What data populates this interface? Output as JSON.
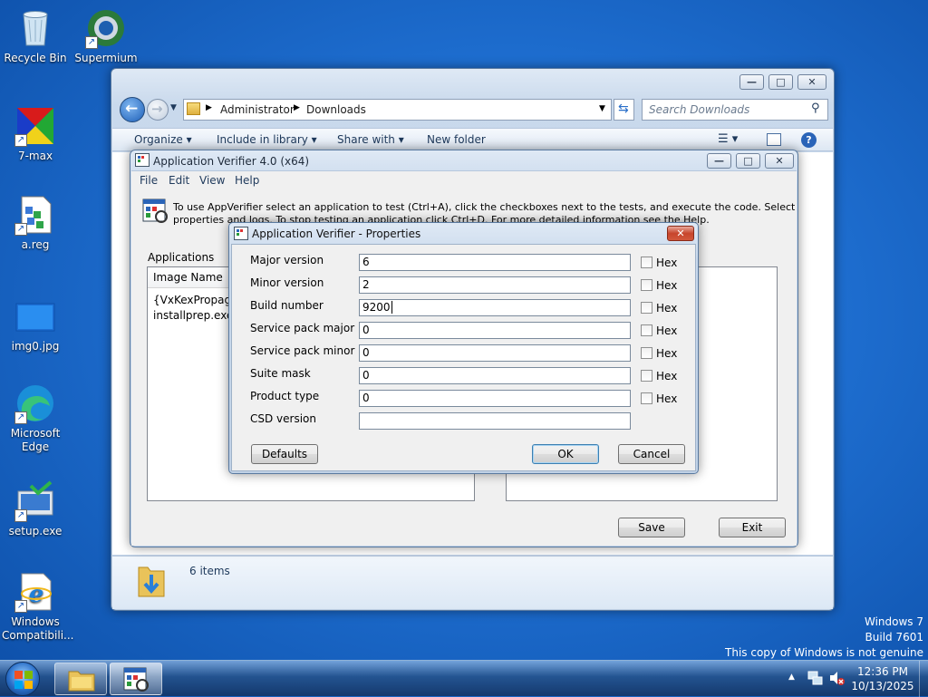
{
  "desktop": {
    "icons": [
      {
        "label": "Recycle Bin"
      },
      {
        "label": "Supermium"
      },
      {
        "label": "7-max"
      },
      {
        "label": "a.reg"
      },
      {
        "label": "img0.jpg"
      },
      {
        "label": "Microsoft Edge"
      },
      {
        "label": "setup.exe"
      },
      {
        "label": "Windows Compatibili..."
      }
    ],
    "watermark": {
      "line1": "Windows 7",
      "line2": "Build 7601",
      "line3": "This copy of Windows is not genuine"
    }
  },
  "explorer": {
    "breadcrumb": [
      "Administrator",
      "Downloads"
    ],
    "search_placeholder": "Search Downloads",
    "toolbar": {
      "organize": "Organize",
      "include_in_library": "Include in library",
      "share_with": "Share with",
      "new_folder": "New folder"
    },
    "status": "6 items"
  },
  "appverifier": {
    "title": "Application Verifier 4.0 (x64)",
    "menu": [
      "File",
      "Edit",
      "View",
      "Help"
    ],
    "info_text_1": "To use AppVerifier select an application to test (Ctrl+A), click the checkboxes next to the tests, and execute the code. Select View to see",
    "info_text_2": "properties and logs. To stop testing an application click Ctrl+D. For more detailed information see the Help.",
    "applications_label": "Applications",
    "column_image_name": "Image Name",
    "rows": [
      "{VxKexPropagatio",
      "installprep.exe"
    ],
    "save_label": "Save",
    "exit_label": "Exit"
  },
  "properties": {
    "title": "Application Verifier - Properties",
    "fields": [
      {
        "label": "Major version",
        "value": "6",
        "hex": true
      },
      {
        "label": "Minor version",
        "value": "2",
        "hex": true
      },
      {
        "label": "Build number",
        "value": "9200",
        "hex": true
      },
      {
        "label": "Service pack major",
        "value": "0",
        "hex": true
      },
      {
        "label": "Service pack minor",
        "value": "0",
        "hex": true
      },
      {
        "label": "Suite mask",
        "value": "0",
        "hex": true
      },
      {
        "label": "Product type",
        "value": "0",
        "hex": true
      },
      {
        "label": "CSD version",
        "value": "",
        "hex": false
      }
    ],
    "hex_label": "Hex",
    "defaults_label": "Defaults",
    "ok_label": "OK",
    "cancel_label": "Cancel"
  },
  "taskbar": {
    "time": "12:36 PM",
    "date": "10/13/2025"
  },
  "icons": {
    "back": "back-arrow-icon",
    "forward": "forward-arrow-icon",
    "refresh": "refresh-icon",
    "search": "search-icon",
    "help": "help-icon",
    "network": "network-icon",
    "volume": "volume-muted-icon"
  }
}
